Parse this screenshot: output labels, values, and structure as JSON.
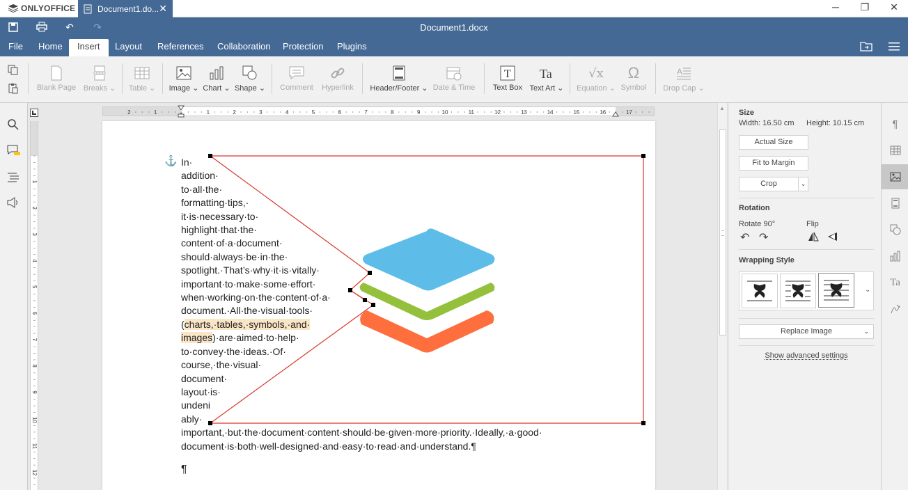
{
  "app": {
    "brand": "ONLYOFFICE",
    "tab_title": "Document1.do...",
    "window_title": "Document1.docx"
  },
  "menu": {
    "tabs": [
      "File",
      "Home",
      "Insert",
      "Layout",
      "References",
      "Collaboration",
      "Protection",
      "Plugins"
    ],
    "active": "Insert"
  },
  "toolbar": {
    "blank_page": "Blank Page",
    "breaks": "Breaks",
    "table": "Table",
    "image": "Image",
    "chart": "Chart",
    "shape": "Shape",
    "comment": "Comment",
    "hyperlink": "Hyperlink",
    "header_footer": "Header/Footer",
    "date_time": "Date & Time",
    "text_box": "Text Box",
    "text_art": "Text Art",
    "equation": "Equation",
    "symbol": "Symbol",
    "drop_cap": "Drop Cap"
  },
  "ruler": {
    "h_labels": [
      "2",
      "1",
      "1",
      "2",
      "3",
      "4",
      "5",
      "6",
      "7",
      "8",
      "9",
      "10",
      "11",
      "12",
      "13",
      "14",
      "15",
      "16",
      "17"
    ],
    "v_labels": [
      "1",
      "2",
      "3",
      "4",
      "5",
      "6",
      "7",
      "8",
      "9",
      "10",
      "11",
      "12"
    ]
  },
  "document": {
    "lines": [
      "In·",
      "addition·",
      "to·all·the·",
      "formatting·tips,·",
      "it·is·necessary·to·",
      "highlight·that·the·",
      "content·of·a·document·",
      "should·always·be·in·the·",
      "spotlight.·That’s·why·it·is·vitally·",
      "important·to·make·some·effort·",
      "when·working·on·the·content·of·a·",
      "document.·All·the·visual·tools·"
    ],
    "line13_pre": "(",
    "line13_hl": "charts,·tables,·symbols,·and·",
    "line14_hl": "images",
    "line14_post": ")·are·aimed·to·help·",
    "lines_after": [
      "to·convey·the·ideas.·Of·",
      "course,·the·visual·",
      "document·",
      "layout·is·",
      "undeni",
      "ably·"
    ],
    "full_lines": [
      "important,·but·the·document·content·should·be·given·more·priority.·Ideally,·a·good·",
      "document·is·both·well-designed·and·easy·to·read·and·understand.¶"
    ],
    "last_para": "¶",
    "anchor": "⚓"
  },
  "right_panel": {
    "size_heading": "Size",
    "width": "Width: 16.50 cm",
    "height": "Height: 10.15 cm",
    "actual_size": "Actual Size",
    "fit_to_margin": "Fit to Margin",
    "crop": "Crop",
    "rotation_heading": "Rotation",
    "rotate90": "Rotate 90°",
    "flip": "Flip",
    "wrapping_heading": "Wrapping Style",
    "replace_image": "Replace Image",
    "advanced": "Show advanced settings"
  },
  "colors": {
    "header": "#446995",
    "logo_blue": "#5dbde8",
    "logo_green": "#95c03c",
    "logo_orange": "#ff6f3d",
    "frame_red": "#d9362a",
    "highlight": "#fbe5c7"
  },
  "icons": [
    "save-icon",
    "print-icon",
    "undo-icon",
    "redo-icon",
    "open-location-icon",
    "hamburger-icon",
    "copy-icon",
    "paste-icon",
    "search-icon",
    "comments-icon",
    "navigation-icon",
    "speaker-icon"
  ]
}
